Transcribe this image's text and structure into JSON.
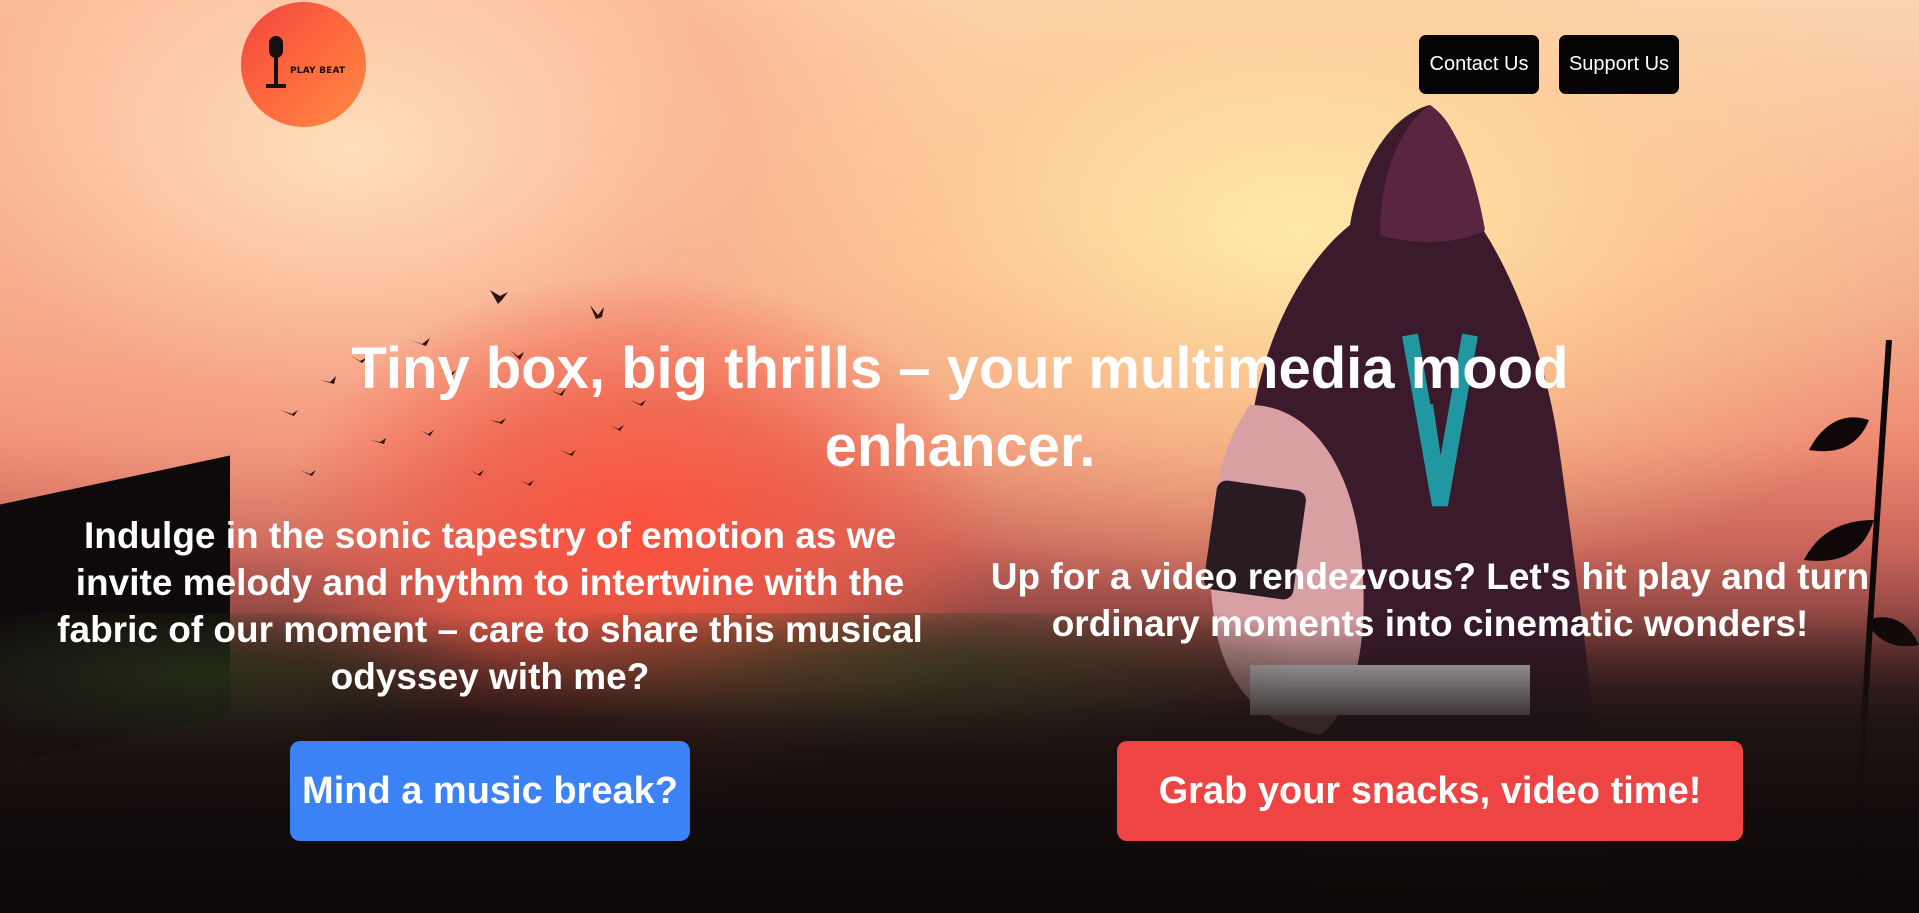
{
  "header": {
    "logo": {
      "text": "PLAY BEAT",
      "icon": "microphone-icon"
    },
    "nav": {
      "contact_label": "Contact Us",
      "support_label": "Support Us"
    }
  },
  "hero": {
    "headline": "Tiny box, big thrills – your multimedia mood enhancer.",
    "music": {
      "text": "Indulge in the sonic tapestry of emotion as we invite melody and rhythm to intertwine with the fabric of our moment – care to share this musical odyssey with me?",
      "button_label": "Mind a music break?"
    },
    "video": {
      "text": "Up for a video rendezvous? Let's hit play and turn ordinary moments into cinematic wonders!",
      "button_label": "Grab your snacks, video time!"
    }
  },
  "colors": {
    "music_button": "#3b82f6",
    "video_button": "#ef4444",
    "nav_button": "#050303",
    "logo": "#ff5a3c"
  }
}
